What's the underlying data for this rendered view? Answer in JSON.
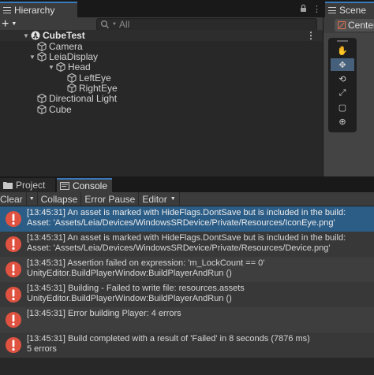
{
  "hierarchy": {
    "tab_label": "Hierarchy",
    "search_placeholder": "All",
    "add_label": "+",
    "items": [
      {
        "label": "CubeTest",
        "icon": "unity-scene-icon"
      },
      {
        "label": "Camera",
        "icon": "cube-icon"
      },
      {
        "label": "LeiaDisplay",
        "icon": "cube-icon"
      },
      {
        "label": "Head",
        "icon": "cube-icon"
      },
      {
        "label": "LeftEye",
        "icon": "cube-icon"
      },
      {
        "label": "RightEye",
        "icon": "cube-icon"
      },
      {
        "label": "Directional Light",
        "icon": "cube-icon"
      },
      {
        "label": "Cube",
        "icon": "cube-icon"
      }
    ]
  },
  "scene": {
    "tab_label": "Scene",
    "center_label": "Center",
    "tools": [
      "hand-tool",
      "move-tool",
      "rotate-tool",
      "scale-tool",
      "rect-tool",
      "transform-tool"
    ],
    "active_tool": "move-tool"
  },
  "console": {
    "tabs": {
      "project": "Project",
      "console": "Console"
    },
    "toolbar": {
      "clear": "Clear",
      "collapse": "Collapse",
      "error_pause": "Error Pause",
      "editor": "Editor"
    },
    "logs": [
      {
        "line1": "[13:45:31] An asset is marked with HideFlags.DontSave but is included in the build:",
        "line2": "Asset: 'Assets/Leia/Devices/WindowsSRDevice/Private/Resources/IconEye.png'"
      },
      {
        "line1": "[13:45:31] An asset is marked with HideFlags.DontSave but is included in the build:",
        "line2": "Asset: 'Assets/Leia/Devices/WindowsSRDevice/Private/Resources/Device.png'"
      },
      {
        "line1": "[13:45:31] Assertion failed on expression: 'm_LockCount == 0'",
        "line2": "UnityEditor.BuildPlayerWindow:BuildPlayerAndRun ()"
      },
      {
        "line1": "[13:45:31] Building - Failed to write file: resources.assets",
        "line2": "UnityEditor.BuildPlayerWindow:BuildPlayerAndRun ()"
      },
      {
        "line1": "[13:45:31] Error building Player: 4 errors",
        "line2": ""
      },
      {
        "line1": "[13:45:31] Build completed with a result of 'Failed' in 8 seconds (7876 ms)",
        "line2": "5 errors"
      }
    ]
  },
  "colors": {
    "accent": "#3a79bb",
    "selection": "#2c5d87",
    "error": "#e05240"
  }
}
